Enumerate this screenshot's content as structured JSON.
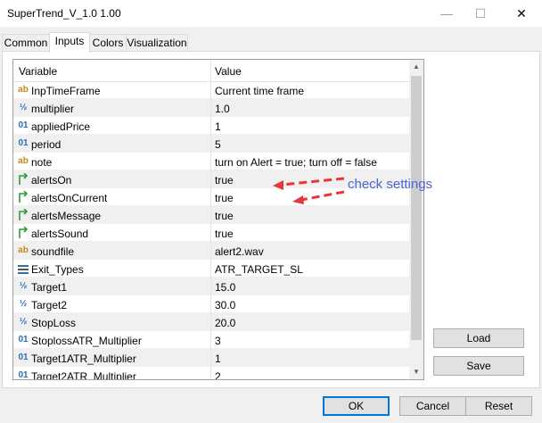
{
  "window": {
    "title": "SuperTrend_V_1.0 1.00",
    "minimize": "—",
    "maximize": "☐",
    "close": "✕"
  },
  "tabs": [
    {
      "label": "Common"
    },
    {
      "label": "Inputs"
    },
    {
      "label": "Colors"
    },
    {
      "label": "Visualization"
    }
  ],
  "active_tab": "Inputs",
  "grid": {
    "headers": {
      "variable": "Variable",
      "value": "Value"
    },
    "rows": [
      {
        "icon": "ab",
        "name": "InpTimeFrame",
        "value": "Current time frame"
      },
      {
        "icon": "½",
        "name": "multiplier",
        "value": "1.0"
      },
      {
        "icon": "01",
        "name": "appliedPrice",
        "value": "1"
      },
      {
        "icon": "01",
        "name": "period",
        "value": "5"
      },
      {
        "icon": "ab",
        "name": "note",
        "value": "turn on Alert = true; turn off = false"
      },
      {
        "icon": "bool",
        "name": "alertsOn",
        "value": "true"
      },
      {
        "icon": "bool",
        "name": "alertsOnCurrent",
        "value": "true"
      },
      {
        "icon": "bool",
        "name": "alertsMessage",
        "value": "true"
      },
      {
        "icon": "bool",
        "name": "alertsSound",
        "value": "true"
      },
      {
        "icon": "ab",
        "name": "soundfile",
        "value": "alert2.wav"
      },
      {
        "icon": "enum",
        "name": "Exit_Types",
        "value": "ATR_TARGET_SL"
      },
      {
        "icon": "½",
        "name": "Target1",
        "value": "15.0"
      },
      {
        "icon": "½",
        "name": "Target2",
        "value": "30.0"
      },
      {
        "icon": "½",
        "name": "StopLoss",
        "value": "20.0"
      },
      {
        "icon": "01",
        "name": "StoplossATR_Multiplier",
        "value": "3"
      },
      {
        "icon": "01",
        "name": "Target1ATR_Multiplier",
        "value": "1"
      },
      {
        "icon": "01",
        "name": "Target2ATR_Multiplier",
        "value": "2"
      }
    ]
  },
  "side_buttons": {
    "load": "Load",
    "save": "Save"
  },
  "bottom_buttons": {
    "ok": "OK",
    "cancel": "Cancel",
    "reset": "Reset"
  },
  "annotation": {
    "text": "check settings",
    "color": "#4a64d6",
    "arrow_color": "#e8373a"
  },
  "colors": {
    "icon_ab": "#c08a1a",
    "icon_num": "#2a6fb8",
    "icon_bool": "#2e9a3c",
    "accent": "#0078d7"
  }
}
